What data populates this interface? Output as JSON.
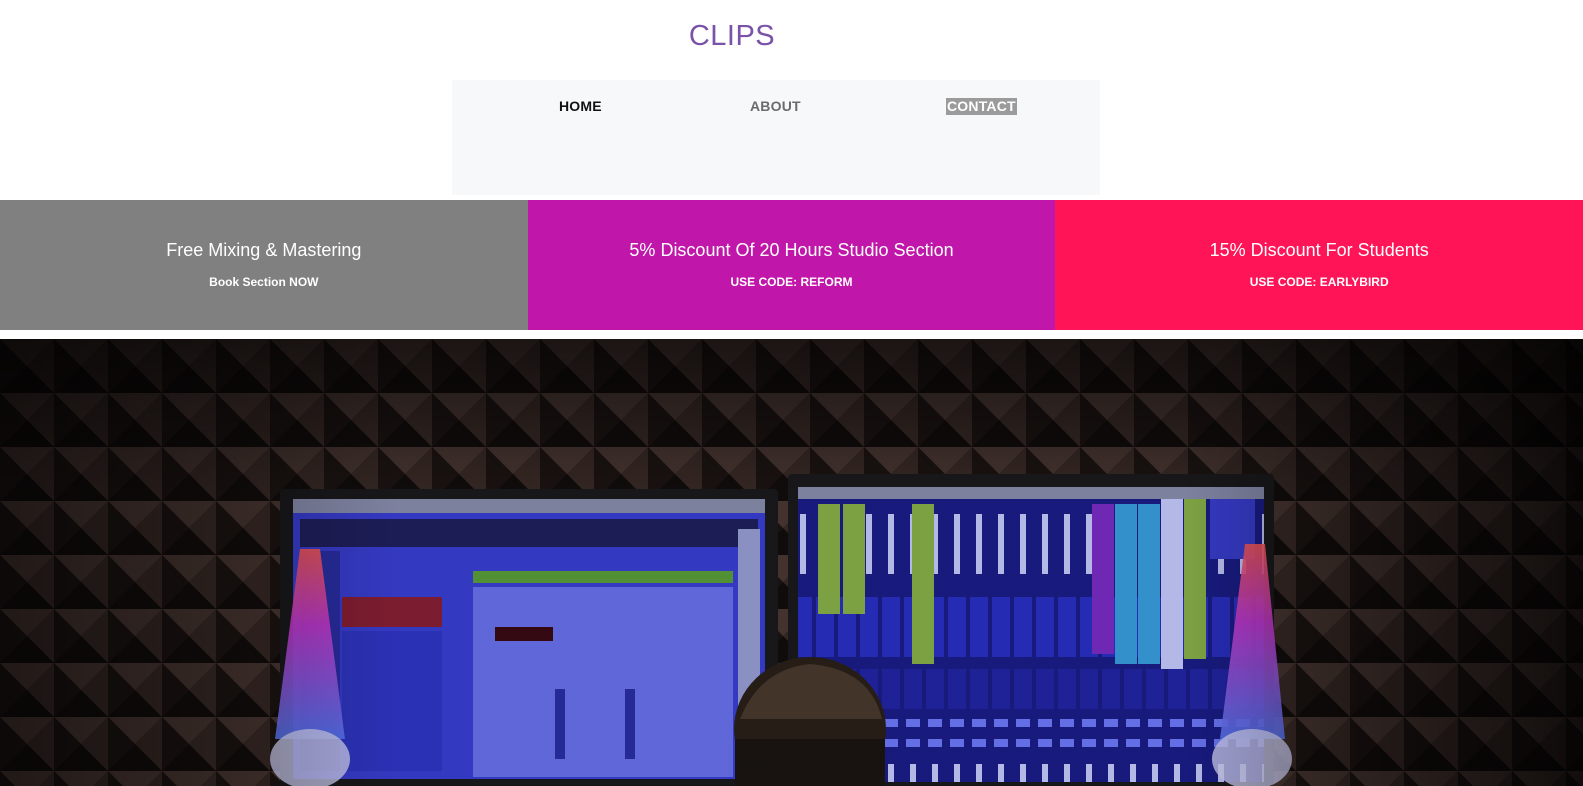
{
  "header": {
    "logo": "CLIPS",
    "logo_color": "#7a52a8"
  },
  "nav": {
    "items": [
      {
        "label": "HOME",
        "state": "active"
      },
      {
        "label": "ABOUT",
        "state": "default"
      },
      {
        "label": "CONTACT",
        "state": "highlighted"
      }
    ]
  },
  "promos": [
    {
      "title": "Free Mixing & Mastering",
      "subtitle": "Book Section NOW",
      "color": "#808080"
    },
    {
      "title": "5% Discount Of 20 Hours Studio Section",
      "subtitle": "USE CODE: REFORM",
      "color": "#c116aa"
    },
    {
      "title": "15% Discount For Students",
      "subtitle": "USE CODE: EARLYBIRD",
      "color": "#fe1457"
    }
  ],
  "hero": {
    "image_subject": "recording-studio-photo",
    "accent": "#3a2bf0"
  }
}
